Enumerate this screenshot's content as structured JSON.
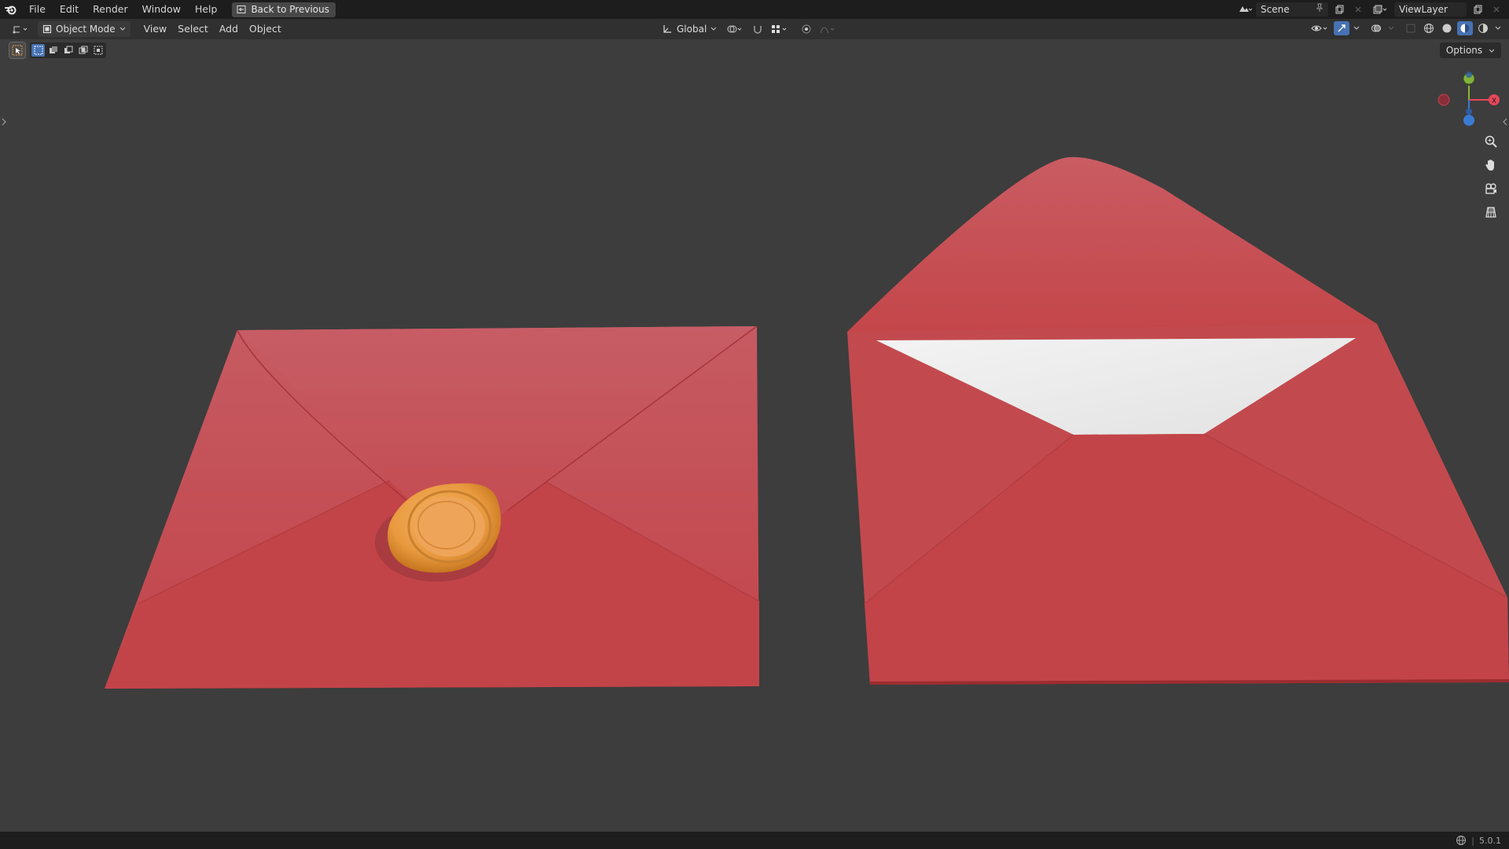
{
  "topbar": {
    "logo_icon": "blender-logo-icon",
    "menus": [
      {
        "label": "File"
      },
      {
        "label": "Edit"
      },
      {
        "label": "Render"
      },
      {
        "label": "Window"
      },
      {
        "label": "Help"
      }
    ],
    "back_button_label": "Back to Previous",
    "scene_name": "Scene",
    "view_layer_name": "ViewLayer"
  },
  "header": {
    "mode_label": "Object Mode",
    "menus": [
      {
        "label": "View"
      },
      {
        "label": "Select"
      },
      {
        "label": "Add"
      },
      {
        "label": "Object"
      }
    ],
    "transform_orientation": "Global"
  },
  "viewport": {
    "options_label": "Options",
    "gizmo_axes": [
      "X",
      "Y",
      "Z"
    ],
    "background_color": "#3d3d3d",
    "envelope_color": "#c44a4e",
    "seal_color": "#e8993e",
    "letter_color": "#ececec"
  },
  "status": {
    "version": "5.0.1"
  }
}
